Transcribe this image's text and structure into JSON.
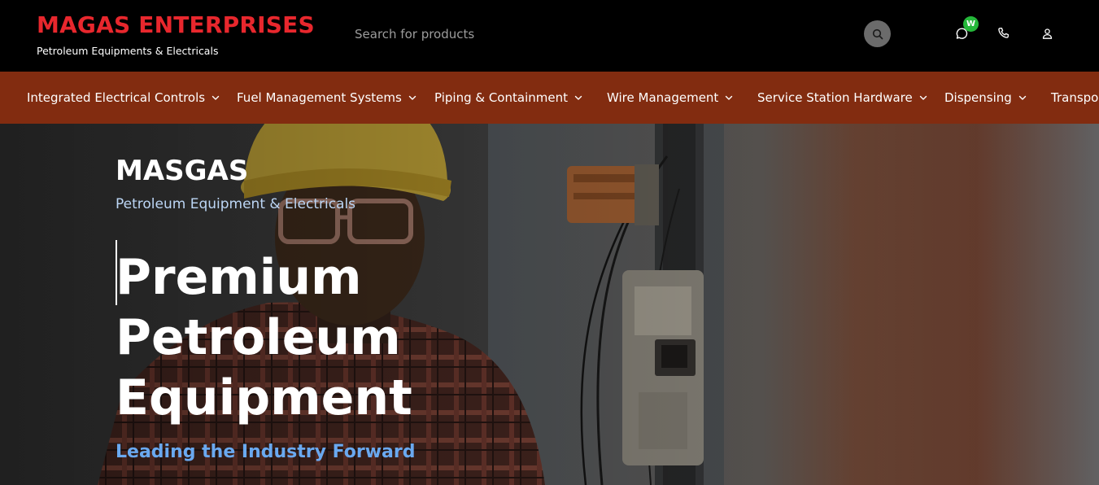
{
  "header": {
    "brand_title": "MAGAS ENTERPRISES",
    "brand_subtitle": "Petroleum Equipments & Electricals",
    "search": {
      "placeholder": "Search for products"
    },
    "whatsapp_badge": "W",
    "icons": [
      "search-icon",
      "chat-icon",
      "phone-icon",
      "user-icon"
    ]
  },
  "nav": {
    "items": [
      {
        "label": "Integrated Electrical Controls"
      },
      {
        "label": "Fuel Management Systems"
      },
      {
        "label": "Piping & Containment"
      },
      {
        "label": "Wire Management"
      },
      {
        "label": "Service Station Hardware"
      },
      {
        "label": "Dispensing"
      },
      {
        "label": "Transpor"
      }
    ]
  },
  "hero": {
    "brand": "MASGAS",
    "subtitle": "Petroleum Equipment & Electricals",
    "title_lines": [
      "Premium",
      "Petroleum",
      "Equipment"
    ],
    "tagline": "Leading the Industry Forward"
  },
  "colors": {
    "brand_red": "#e8272d",
    "nav_bg": "#822c10",
    "badge_green": "#25b83a",
    "tagline_blue": "#6aa9f0",
    "subtitle_blue": "#bcd6f5"
  }
}
